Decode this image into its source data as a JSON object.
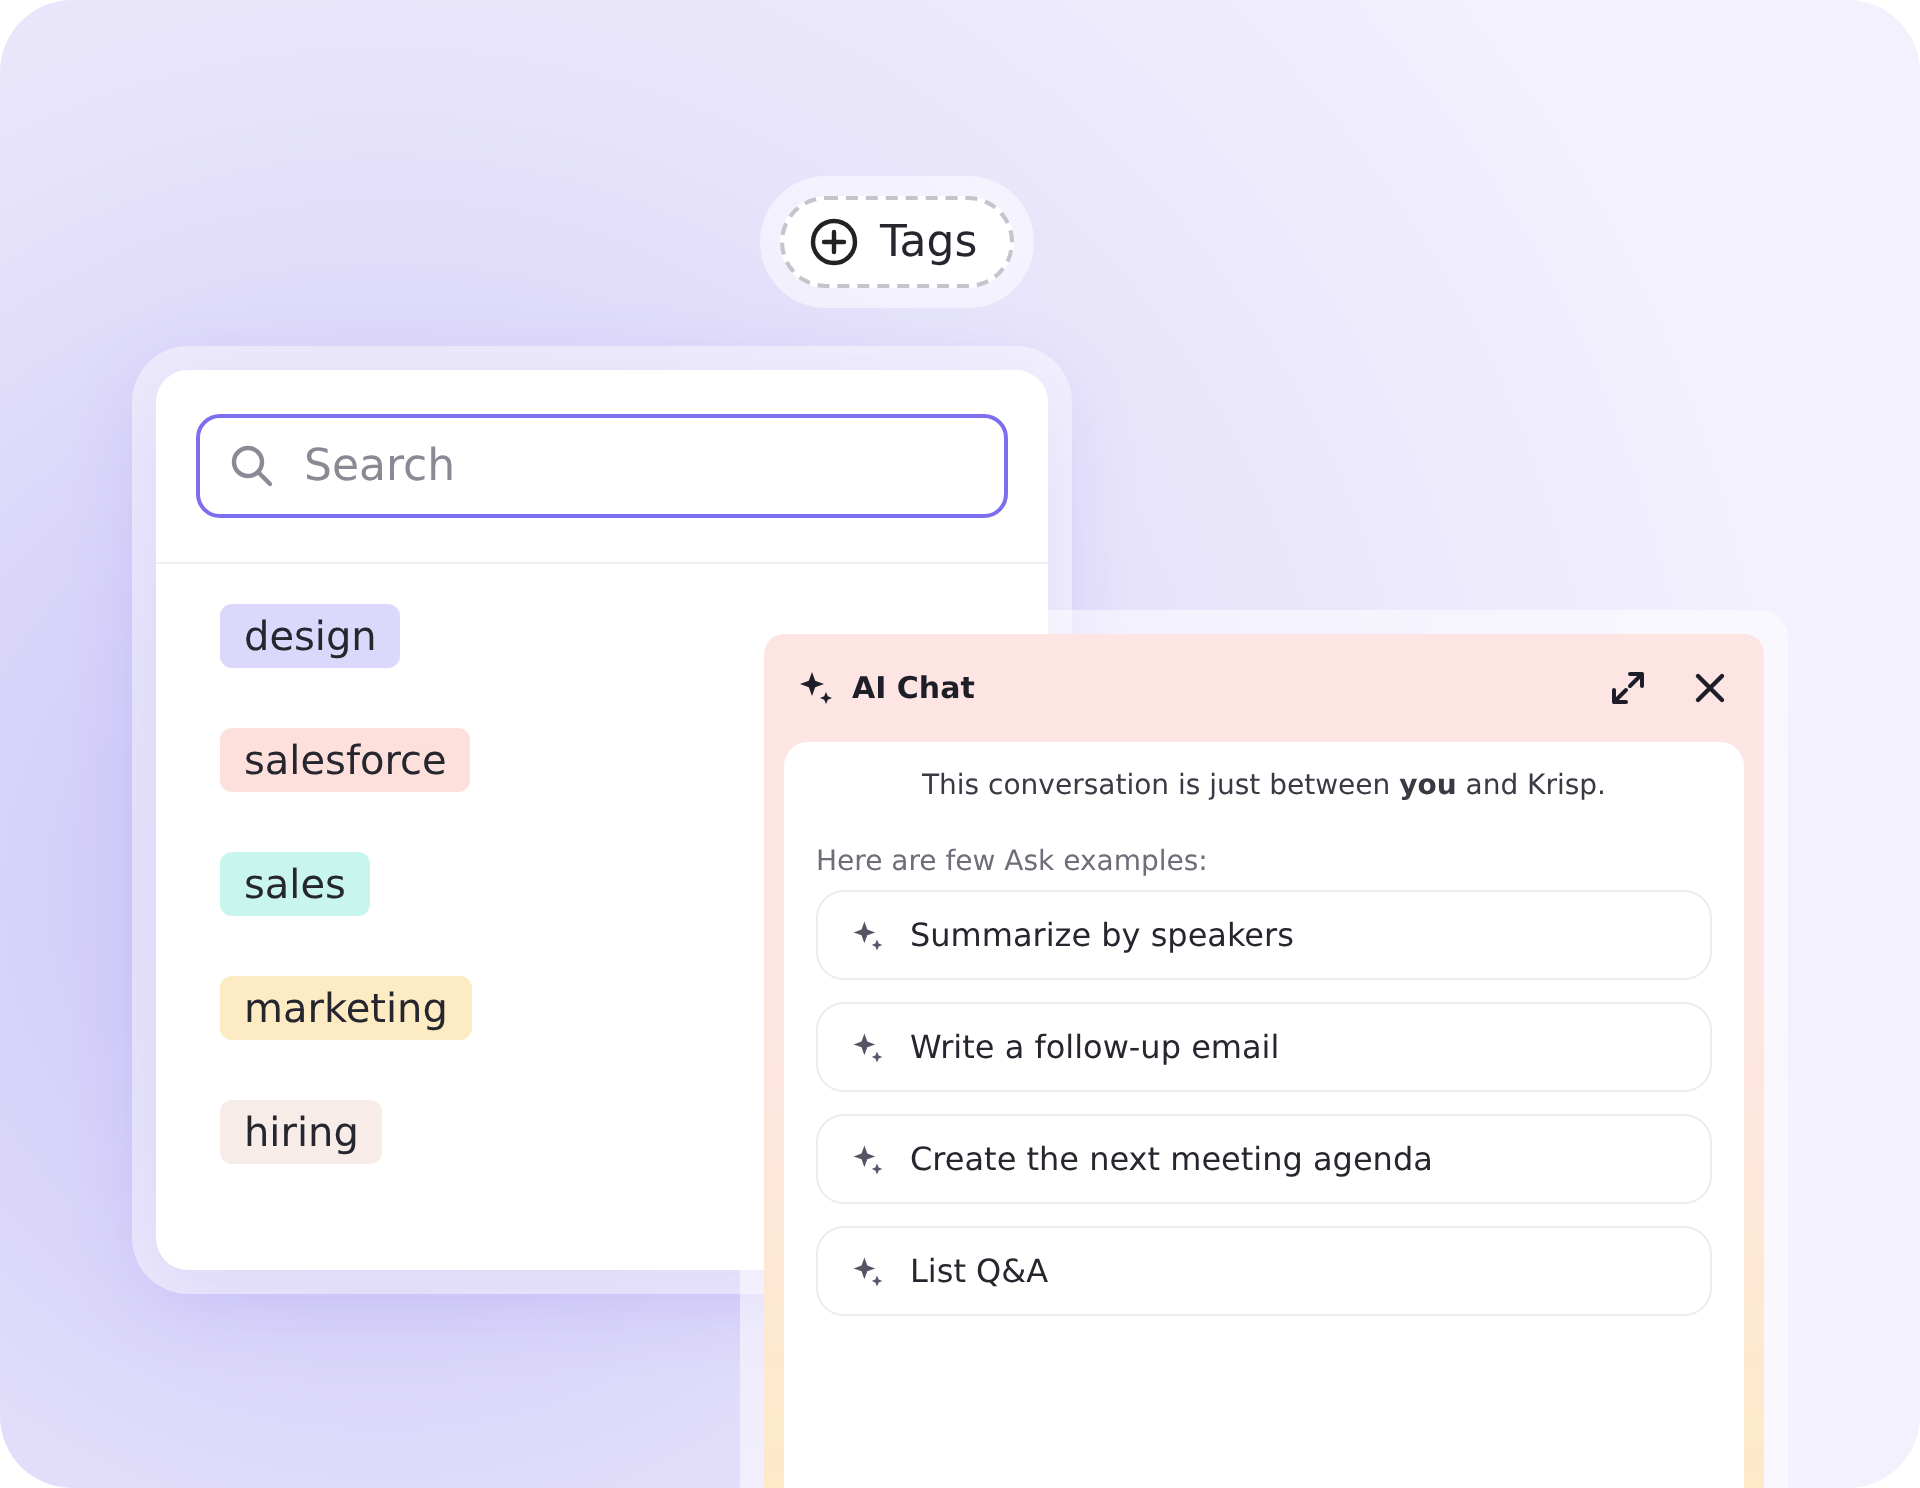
{
  "tags_button": {
    "label": "Tags"
  },
  "search": {
    "placeholder": "Search"
  },
  "tags": [
    {
      "label": "design",
      "color": "#dcd8fb"
    },
    {
      "label": "salesforce",
      "color": "#fde0dc"
    },
    {
      "label": "sales",
      "color": "#c8f5ec"
    },
    {
      "label": "marketing",
      "color": "#fdebc4"
    },
    {
      "label": "hiring",
      "color": "#f8ece9"
    }
  ],
  "ai_chat": {
    "title": "AI Chat",
    "notice": "This conversation is just between **you** and Krisp.",
    "examples_label": "Here are few Ask examples:",
    "examples": [
      "Summarize by speakers",
      "Write a follow-up email",
      "Create the next meeting agenda",
      "List Q&A"
    ]
  }
}
